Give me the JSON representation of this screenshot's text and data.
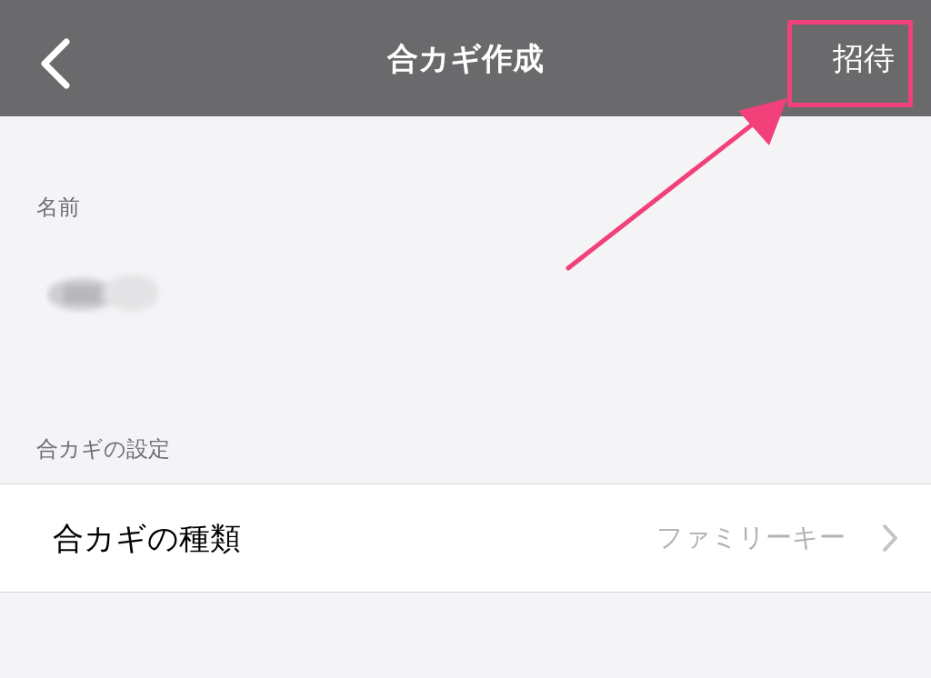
{
  "nav_bar": {
    "title": "合カギ作成",
    "action": "招待"
  },
  "sections": [
    {
      "kind": "field",
      "header": "名前"
    },
    {
      "kind": "list",
      "header": "合カギの設定",
      "rows": [
        {
          "label": "合カギの種類",
          "value": "ファミリーキー"
        }
      ]
    }
  ]
}
